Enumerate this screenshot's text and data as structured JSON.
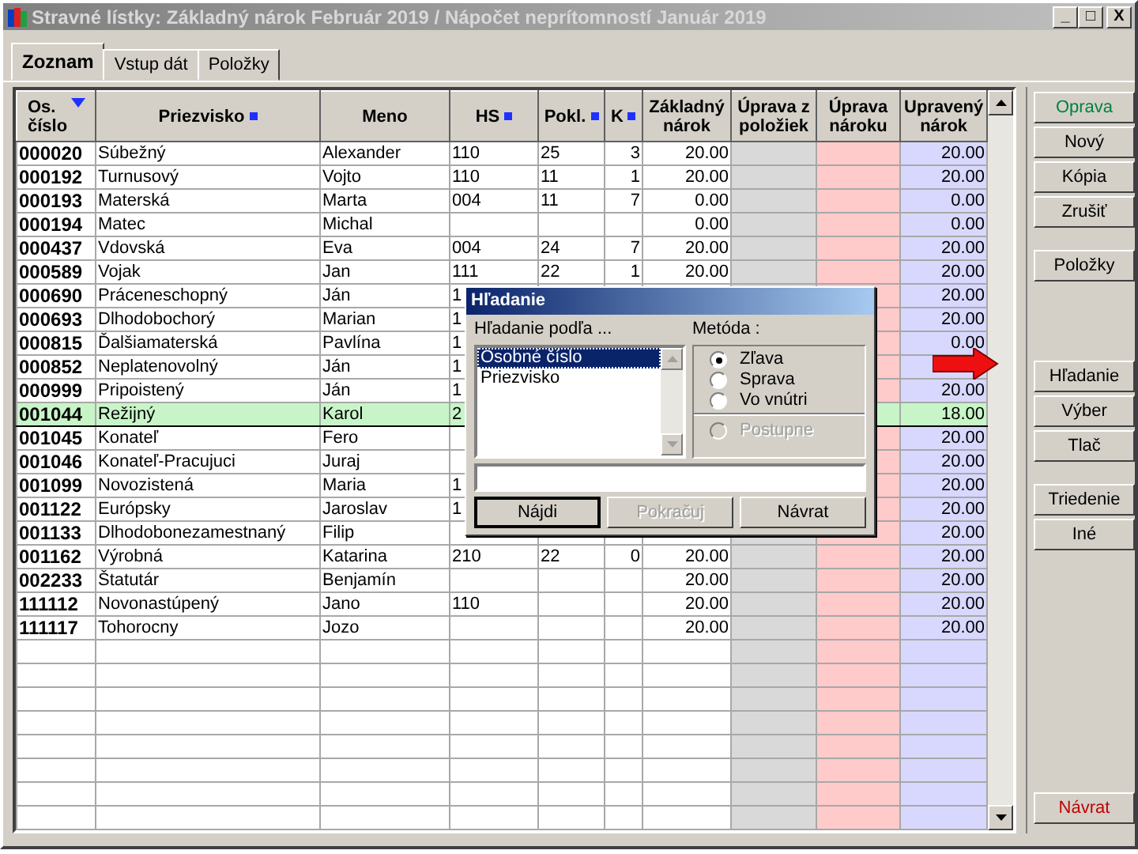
{
  "window": {
    "title": "Stravné lístky:  Základný nárok Február 2019  /  Nápočet neprítomností Január 2019",
    "controls": [
      "_",
      "□",
      "X"
    ]
  },
  "tabs": [
    {
      "label": "Zoznam",
      "selected": true
    },
    {
      "label": "Vstup dát",
      "selected": false
    },
    {
      "label": "Položky",
      "selected": false
    }
  ],
  "table": {
    "columns": [
      {
        "label": "Os. číslo",
        "sorted_desc": true,
        "marked": false,
        "kind": "id"
      },
      {
        "label": "Priezvisko",
        "sorted_desc": false,
        "marked": true,
        "kind": "text"
      },
      {
        "label": "Meno",
        "sorted_desc": false,
        "marked": false,
        "kind": "text"
      },
      {
        "label": "HS",
        "sorted_desc": false,
        "marked": true,
        "kind": "text"
      },
      {
        "label": "Pokl.",
        "sorted_desc": false,
        "marked": true,
        "kind": "text"
      },
      {
        "label": "K",
        "sorted_desc": false,
        "marked": true,
        "kind": "num"
      },
      {
        "label": "Základný nárok",
        "sorted_desc": false,
        "marked": false,
        "kind": "num"
      },
      {
        "label": "Úprava z položiek",
        "sorted_desc": false,
        "marked": false,
        "kind": "grey"
      },
      {
        "label": "Úprava nároku",
        "sorted_desc": false,
        "marked": false,
        "kind": "pink"
      },
      {
        "label": "Upravený nárok",
        "sorted_desc": false,
        "marked": false,
        "kind": "blue"
      }
    ],
    "rows": [
      {
        "selected": false,
        "cells": [
          "000020",
          "Súbežný",
          "Alexander",
          "110",
          "25",
          "3",
          "20.00",
          "",
          "",
          "20.00"
        ]
      },
      {
        "selected": false,
        "cells": [
          "000192",
          "Turnusový",
          "Vojto",
          "110",
          "11",
          "1",
          "20.00",
          "",
          "",
          "20.00"
        ]
      },
      {
        "selected": false,
        "cells": [
          "000193",
          "Materská",
          "Marta",
          "004",
          "11",
          "7",
          "0.00",
          "",
          "",
          "0.00"
        ]
      },
      {
        "selected": false,
        "cells": [
          "000194",
          "Matec",
          "Michal",
          "",
          "",
          "",
          "0.00",
          "",
          "",
          "0.00"
        ]
      },
      {
        "selected": false,
        "cells": [
          "000437",
          "Vdovská",
          "Eva",
          "004",
          "24",
          "7",
          "20.00",
          "",
          "",
          "20.00"
        ]
      },
      {
        "selected": false,
        "cells": [
          "000589",
          "Vojak",
          "Jan",
          "111",
          "22",
          "1",
          "20.00",
          "",
          "",
          "20.00"
        ]
      },
      {
        "selected": false,
        "cells": [
          "000690",
          "Práceneschopný",
          "Ján",
          "1",
          "",
          "",
          "",
          "",
          "",
          "20.00"
        ]
      },
      {
        "selected": false,
        "cells": [
          "000693",
          "Dlhodobochorý",
          "Marian",
          "1",
          "",
          "",
          "",
          "",
          "",
          "20.00"
        ]
      },
      {
        "selected": false,
        "cells": [
          "000815",
          "Ďalšiamaterská",
          "Pavlína",
          "1",
          "",
          "",
          "",
          "",
          "",
          "0.00"
        ]
      },
      {
        "selected": false,
        "cells": [
          "000852",
          "Neplatenovolný",
          "Ján",
          "1",
          "",
          "",
          "",
          "",
          "",
          ""
        ]
      },
      {
        "selected": false,
        "cells": [
          "000999",
          "Pripoistený",
          "Ján",
          "1",
          "",
          "",
          "",
          "",
          "",
          "20.00"
        ]
      },
      {
        "selected": true,
        "cells": [
          "001044",
          "Režijný",
          "Karol",
          "2",
          "",
          "",
          "",
          "",
          "",
          "18.00"
        ]
      },
      {
        "selected": false,
        "cells": [
          "001045",
          "Konateľ",
          "Fero",
          "",
          "",
          "",
          "",
          "",
          "",
          "20.00"
        ]
      },
      {
        "selected": false,
        "cells": [
          "001046",
          "Konateľ-Pracujuci",
          "Juraj",
          "",
          "",
          "",
          "",
          "",
          "",
          "20.00"
        ]
      },
      {
        "selected": false,
        "cells": [
          "001099",
          "Novozistená",
          "Maria",
          "1",
          "",
          "",
          "",
          "",
          "",
          "20.00"
        ]
      },
      {
        "selected": false,
        "cells": [
          "001122",
          "Európsky",
          "Jaroslav",
          "1",
          "",
          "",
          "",
          "",
          "",
          "20.00"
        ]
      },
      {
        "selected": false,
        "cells": [
          "001133",
          "Dlhodobonezamestnaný",
          "Filip",
          "",
          "",
          "",
          "",
          "",
          "",
          "20.00"
        ]
      },
      {
        "selected": false,
        "cells": [
          "001162",
          "Výrobná",
          "Katarina",
          "210",
          "22",
          "0",
          "20.00",
          "",
          "",
          "20.00"
        ]
      },
      {
        "selected": false,
        "cells": [
          "002233",
          "Štatutár",
          "Benjamín",
          "",
          "",
          "",
          "20.00",
          "",
          "",
          "20.00"
        ]
      },
      {
        "selected": false,
        "cells": [
          "111112",
          "Novonastúpený",
          "Jano",
          "110",
          "",
          "",
          "20.00",
          "",
          "",
          "20.00"
        ]
      },
      {
        "selected": false,
        "cells": [
          "111117",
          "Tohorocny",
          "Jozo",
          "",
          "",
          "",
          "20.00",
          "",
          "",
          "20.00"
        ]
      }
    ]
  },
  "button_groups": [
    [
      {
        "label": "Oprava",
        "color": "#008040"
      },
      {
        "label": "Nový",
        "color": "#000000"
      },
      {
        "label": "Kópia",
        "color": "#000000"
      },
      {
        "label": "Zrušiť",
        "color": "#000000"
      }
    ],
    [
      {
        "label": "Položky",
        "color": "#000000"
      }
    ],
    [
      {
        "label": "Hľadanie",
        "color": "#000000"
      },
      {
        "label": "Výber",
        "color": "#000000"
      },
      {
        "label": "Tlač",
        "color": "#000000"
      }
    ],
    [
      {
        "label": "Triedenie",
        "color": "#000000"
      },
      {
        "label": "Iné",
        "color": "#000000"
      }
    ]
  ],
  "close_button": {
    "label": "Návrat",
    "color": "#c00000"
  },
  "dialog": {
    "title": "Hľadanie",
    "search_by_label": "Hľadanie podľa ...",
    "search_by": [
      {
        "label": "Osobné číslo",
        "selected": true
      },
      {
        "label": "Priezvisko",
        "selected": false
      }
    ],
    "method_label": "Metóda :",
    "methods": [
      {
        "label": "Zľava",
        "selected": true,
        "disabled": false
      },
      {
        "label": "Sprava",
        "selected": false,
        "disabled": false
      },
      {
        "label": "Vo vnútri",
        "selected": false,
        "disabled": false
      }
    ],
    "progressive": {
      "label": "Postupne",
      "selected": false,
      "disabled": true
    },
    "buttons": [
      {
        "label": "Nájdi",
        "disabled": false,
        "default": true
      },
      {
        "label": "Pokračuj",
        "disabled": true,
        "default": false
      },
      {
        "label": "Návrat",
        "disabled": false,
        "default": false
      }
    ]
  }
}
